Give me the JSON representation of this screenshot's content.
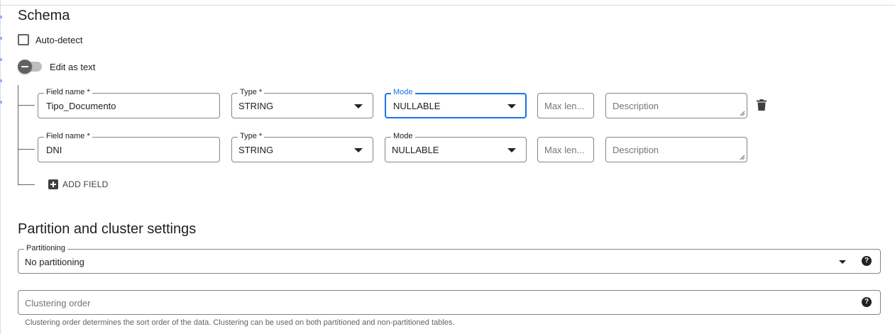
{
  "schema": {
    "title": "Schema",
    "auto_detect_label": "Auto-detect",
    "auto_detect_checked": false,
    "edit_as_text_label": "Edit as text",
    "edit_as_text_on": false,
    "fields": [
      {
        "name_label": "Field name *",
        "name_value": "Tipo_Documento",
        "type_label": "Type *",
        "type_value": "STRING",
        "mode_label": "Mode",
        "mode_value": "NULLABLE",
        "max_length_placeholder": "Max len...",
        "description_placeholder": "Description"
      },
      {
        "name_label": "Field name *",
        "name_value": "DNI",
        "type_label": "Type *",
        "type_value": "STRING",
        "mode_label": "Mode",
        "mode_value": "NULLABLE",
        "max_length_placeholder": "Max len...",
        "description_placeholder": "Description"
      }
    ],
    "add_field_label": "ADD FIELD"
  },
  "partition": {
    "title": "Partition and cluster settings",
    "partitioning_label": "Partitioning",
    "partitioning_value": "No partitioning",
    "clustering_placeholder": "Clustering order",
    "clustering_hint": "Clustering order determines the sort order of the data. Clustering can be used on both partitioned and non-partitioned tables."
  },
  "icons": {
    "help": "?",
    "delete": "trash-icon",
    "dropdown": "chevron-down-icon",
    "add": "add-box-icon"
  },
  "colors": {
    "focus": "#1a73e8",
    "border": "#80868b",
    "text": "#202124",
    "hint": "#5f6368"
  }
}
